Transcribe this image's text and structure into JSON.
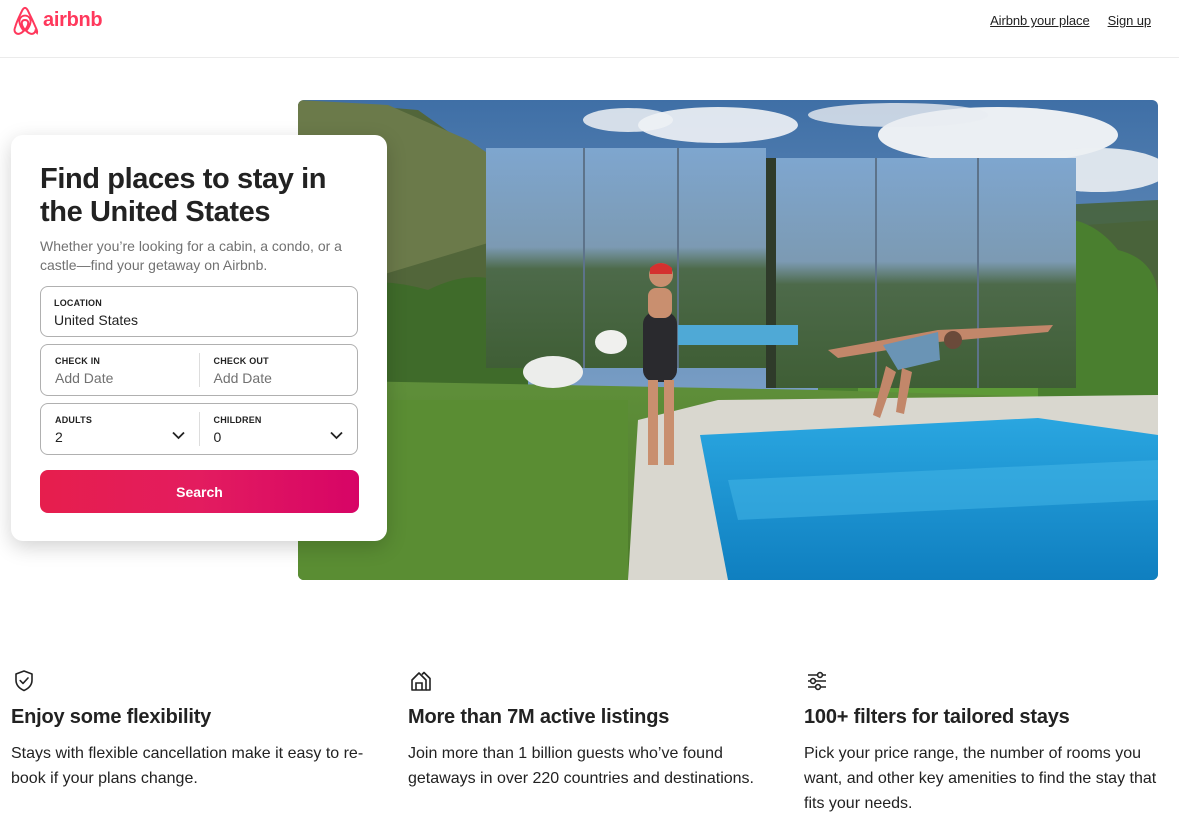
{
  "header": {
    "logo_text": "airbnb",
    "links": [
      "Airbnb your place",
      "Sign up"
    ]
  },
  "search_card": {
    "title": "Find places to stay in the United States",
    "subtitle": "Whether you’re looking for a cabin, a condo, or a castle—find your getaway on Airbnb.",
    "location": {
      "label": "LOCATION",
      "value": "United States"
    },
    "check_in": {
      "label": "CHECK IN",
      "placeholder": "Add Date"
    },
    "check_out": {
      "label": "CHECK OUT",
      "placeholder": "Add Date"
    },
    "adults": {
      "label": "ADULTS",
      "value": "2"
    },
    "children": {
      "label": "CHILDREN",
      "value": "0"
    },
    "search_label": "Search"
  },
  "features": [
    {
      "icon": "shield-check-icon",
      "title": "Enjoy some flexibility",
      "text": "Stays with flexible cancellation make it easy to re-book if your plans change."
    },
    {
      "icon": "homes-icon",
      "title": "More than 7M active listings",
      "text": "Join more than 1 billion guests who’ve found getaways in over 220 countries and destinations."
    },
    {
      "icon": "filters-icon",
      "title": "100+ filters for tailored stays",
      "text": "Pick your price range, the number of rooms you want, and other key amenities to find the stay that fits your needs."
    }
  ],
  "colors": {
    "brand": "#ff385c",
    "button_start": "#e61e4d",
    "button_end": "#d70466"
  }
}
